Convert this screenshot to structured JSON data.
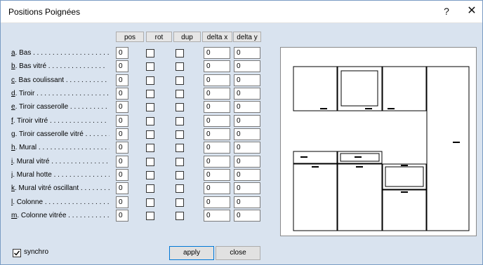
{
  "window": {
    "title": "Positions Poignées",
    "help_label": "?",
    "close_glyph": "✕"
  },
  "columns": [
    "pos",
    "rot",
    "dup",
    "delta x",
    "delta y"
  ],
  "rows": [
    {
      "key": "a",
      "label": ". Bas . . . . . . . . . . . . . . . . . . . .",
      "pos": "0",
      "rot": false,
      "dup": false,
      "delta_x": "0",
      "delta_y": "0"
    },
    {
      "key": "b",
      "label": ". Bas vitré . . . . . . . . . . . . . . .",
      "pos": "0",
      "rot": false,
      "dup": false,
      "delta_x": "0",
      "delta_y": "0"
    },
    {
      "key": "c",
      "label": ". Bas coulissant . . . . . . . . . . .",
      "pos": "0",
      "rot": false,
      "dup": false,
      "delta_x": "0",
      "delta_y": "0"
    },
    {
      "key": "d",
      "label": ". Tiroir . . . . . . . . . . . . . . . . . . . .",
      "pos": "0",
      "rot": false,
      "dup": false,
      "delta_x": "0",
      "delta_y": "0"
    },
    {
      "key": "e",
      "label": ". Tiroir casserolle . . . . . . . . . . .",
      "pos": "0",
      "rot": false,
      "dup": false,
      "delta_x": "0",
      "delta_y": "0"
    },
    {
      "key": "f",
      "label": ". Tiroir vitré . . . . . . . . . . . . . . .",
      "pos": "0",
      "rot": false,
      "dup": false,
      "delta_x": "0",
      "delta_y": "0"
    },
    {
      "key": "g",
      "label": ". Tiroir casserolle vitré . . . . . . .",
      "pos": "0",
      "rot": false,
      "dup": false,
      "delta_x": "0",
      "delta_y": "0"
    },
    {
      "key": "h",
      "label": ". Mural . . . . . . . . . . . . . . . . . . .",
      "pos": "0",
      "rot": false,
      "dup": false,
      "delta_x": "0",
      "delta_y": "0"
    },
    {
      "key": "i",
      "label": ". Mural vitré . . . . . . . . . . . . . . .",
      "pos": "0",
      "rot": false,
      "dup": false,
      "delta_x": "0",
      "delta_y": "0"
    },
    {
      "key": "j",
      "label": ". Mural hotte . . . . . . . . . . . . . . .",
      "pos": "0",
      "rot": false,
      "dup": false,
      "delta_x": "0",
      "delta_y": "0"
    },
    {
      "key": "k",
      "label": ". Mural vitré oscillant . . . . . . . .",
      "pos": "0",
      "rot": false,
      "dup": false,
      "delta_x": "0",
      "delta_y": "0"
    },
    {
      "key": "l",
      "label": ". Colonne . . . . . . . . . . . . . . . . .",
      "pos": "0",
      "rot": false,
      "dup": false,
      "delta_x": "0",
      "delta_y": "0"
    },
    {
      "key": "m",
      "label": ". Colonne vitrée . . . . . . . . . . .",
      "pos": "0",
      "rot": false,
      "dup": false,
      "delta_x": "0",
      "delta_y": "0"
    }
  ],
  "footer": {
    "synchro_label": "synchro",
    "synchro_checked": true,
    "apply_label": "apply",
    "close_label": "close"
  }
}
